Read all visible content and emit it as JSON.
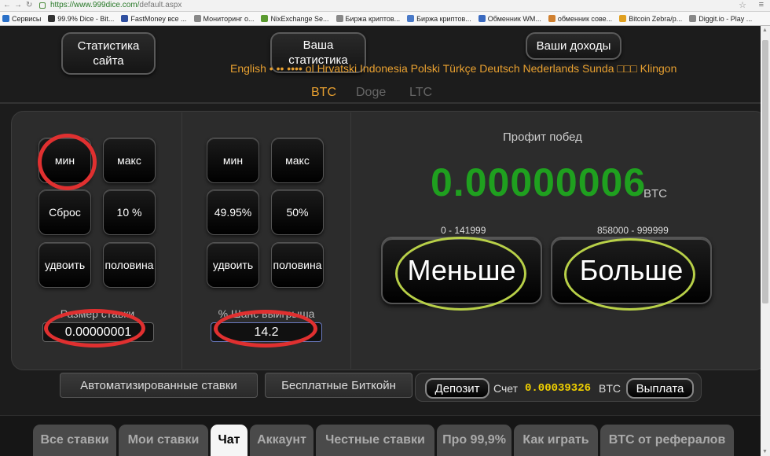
{
  "browser": {
    "url_host": "https://www.999dice.com/",
    "url_path": "default.aspx",
    "bookmarks": [
      "Сервисы",
      "99.9% Dice - Bit...",
      "FastMoney все ...",
      "Мониторинг о...",
      "NixExchange Se...",
      "Биржа криптов...",
      "Биржа криптов...",
      "Обменник WM...",
      "обменник сове...",
      "Bitcoin Zebra/p...",
      "Diggit.io - Play ..."
    ],
    "bookmark_colors": [
      "#2a70c8",
      "#333333",
      "#3050a0",
      "#888888",
      "#5a9a30",
      "#888888",
      "#4a7ac8",
      "#3a6ac0",
      "#d08030",
      "#e0a020",
      "#888888"
    ]
  },
  "header": {
    "nav_site_stats": "Статистика сайта",
    "nav_your_stats": "Ваша статистика",
    "nav_your_income": "Ваши доходы",
    "languages": "English … … ... … Español Hrvatski Indonesia Polski Türkçe Deutsch Nederlands Sunda □□□ Klingon",
    "languages_visible": "English • •• •••• ol Hrvatski Indonesia Polski Türkçe Deutsch Nederlands Sunda □□□ Klingon",
    "currencies": [
      "BTC",
      "Doge",
      "LTC"
    ],
    "active_currency": "BTC"
  },
  "bet_panel": {
    "min_label": "мин",
    "max_label": "макс",
    "reset_label": "Сброс",
    "ten_pct_label": "10 %",
    "double_label": "удвоить",
    "half_label": "половина",
    "bet_size_label": "Размер ставки",
    "bet_size_value": "0.00000001"
  },
  "chance_panel": {
    "min_label": "мин",
    "max_label": "макс",
    "p4995_label": "49.95%",
    "p50_label": "50%",
    "double_label": "удвоить",
    "half_label": "половина",
    "chance_label": "% Шанс выигрыша",
    "chance_value": "14.2"
  },
  "roll_panel": {
    "profit_label": "Профит побед",
    "profit_value": "0.00000006",
    "profit_unit": "BTC",
    "low_range": "0 - 141999",
    "high_range": "858000 - 999999",
    "low_button": "Меньше",
    "high_button": "Больше"
  },
  "lower": {
    "auto_bets": "Автоматизированные ставки",
    "free_btc": "Бесплатные Биткойн",
    "deposit": "Депозит",
    "balance_label": "Счет",
    "balance_value": "0.00039326",
    "balance_unit": "BTC",
    "withdraw": "Выплата"
  },
  "tabs": [
    "Все ставки",
    "Мои ставки",
    "Чат",
    "Аккаунт",
    "Честные ставки",
    "Про 99,9%",
    "Как играть",
    "BTC от рефералов"
  ],
  "active_tab": "Чат",
  "colors": {
    "accent_orange": "#e8a030",
    "profit_green": "#1fa01f",
    "balance_yellow": "#f0d000",
    "annotation_red": "#e03030",
    "annotation_green": "#b8d048"
  }
}
